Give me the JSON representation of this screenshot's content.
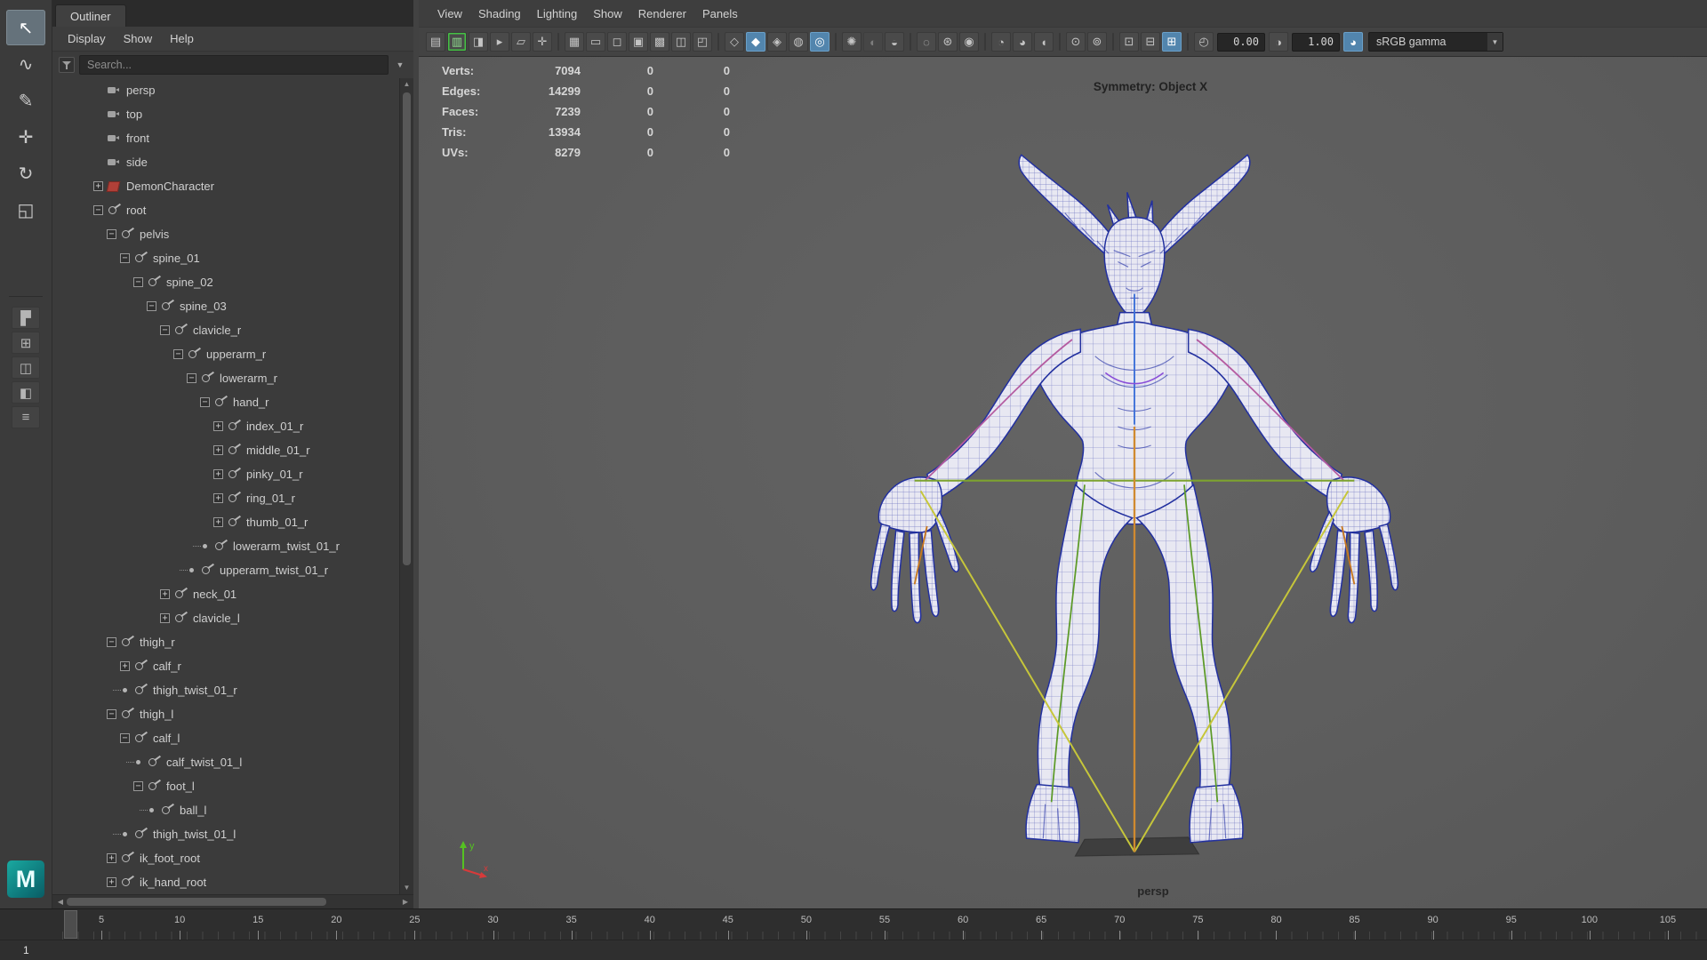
{
  "colors": {
    "accent_blue": "#5285ad",
    "keyed_green": "#44c244",
    "wireframe_navy": "#22309f",
    "skeleton_green": "#7da32f",
    "skeleton_yellow": "#c6c63a",
    "skeleton_orange": "#d08a30",
    "skeleton_magenta": "#b45aa0",
    "maya_teal": "#0d7377"
  },
  "branding": {
    "logo_text": "M"
  },
  "toolbox": {
    "tools": [
      {
        "name": "select-tool",
        "glyph": "↖",
        "state": "active"
      },
      {
        "name": "lasso-select-tool",
        "glyph": "∿",
        "state": ""
      },
      {
        "name": "paint-select-tool",
        "glyph": "✎",
        "state": ""
      },
      {
        "name": "move-tool",
        "glyph": "✛",
        "state": ""
      },
      {
        "name": "rotate-tool",
        "glyph": "↻",
        "state": ""
      },
      {
        "name": "scale-tool",
        "glyph": "◱",
        "state": ""
      }
    ],
    "layouts": [
      {
        "name": "quick-layout-single-pane-button",
        "glyph": "▛"
      },
      {
        "name": "quick-layout-four-pane-button",
        "glyph": "⊞"
      },
      {
        "name": "quick-layout-two-pane-button",
        "glyph": "◫"
      },
      {
        "name": "quick-layout-persp-outliner-button",
        "glyph": "◧"
      },
      {
        "name": "outliner-layout-button",
        "glyph": "≡"
      }
    ]
  },
  "outliner": {
    "tab": "Outliner",
    "menus": [
      {
        "label": "Display",
        "dn": "menu-display"
      },
      {
        "label": "Show",
        "dn": "menu-show"
      },
      {
        "label": "Help",
        "dn": "menu-help"
      }
    ],
    "search_placeholder": "Search...",
    "items": [
      {
        "label": "persp",
        "depth": 0,
        "icon": "camera",
        "exp": "none"
      },
      {
        "label": "top",
        "depth": 0,
        "icon": "camera",
        "exp": "none"
      },
      {
        "label": "front",
        "depth": 0,
        "icon": "camera",
        "exp": "none"
      },
      {
        "label": "side",
        "depth": 0,
        "icon": "camera",
        "exp": "none"
      },
      {
        "label": "DemonCharacter",
        "depth": 0,
        "icon": "mesh",
        "exp": "closed"
      },
      {
        "label": "root",
        "depth": 0,
        "icon": "joint",
        "exp": "open"
      },
      {
        "label": "pelvis",
        "depth": 1,
        "icon": "joint",
        "exp": "open"
      },
      {
        "label": "spine_01",
        "depth": 2,
        "icon": "joint",
        "exp": "open"
      },
      {
        "label": "spine_02",
        "depth": 3,
        "icon": "joint",
        "exp": "open"
      },
      {
        "label": "spine_03",
        "depth": 4,
        "icon": "joint",
        "exp": "open"
      },
      {
        "label": "clavicle_r",
        "depth": 5,
        "icon": "joint",
        "exp": "open"
      },
      {
        "label": "upperarm_r",
        "depth": 6,
        "icon": "joint",
        "exp": "open"
      },
      {
        "label": "lowerarm_r",
        "depth": 7,
        "icon": "joint",
        "exp": "open"
      },
      {
        "label": "hand_r",
        "depth": 8,
        "icon": "joint",
        "exp": "open"
      },
      {
        "label": "index_01_r",
        "depth": 9,
        "icon": "joint",
        "exp": "closed"
      },
      {
        "label": "middle_01_r",
        "depth": 9,
        "icon": "joint",
        "exp": "closed"
      },
      {
        "label": "pinky_01_r",
        "depth": 9,
        "icon": "joint",
        "exp": "closed"
      },
      {
        "label": "ring_01_r",
        "depth": 9,
        "icon": "joint",
        "exp": "closed"
      },
      {
        "label": "thumb_01_r",
        "depth": 9,
        "icon": "joint",
        "exp": "closed"
      },
      {
        "label": "lowerarm_twist_01_r",
        "depth": 8,
        "icon": "joint",
        "exp": "leaf"
      },
      {
        "label": "upperarm_twist_01_r",
        "depth": 7,
        "icon": "joint",
        "exp": "leaf"
      },
      {
        "label": "neck_01",
        "depth": 5,
        "icon": "joint",
        "exp": "closed"
      },
      {
        "label": "clavicle_l",
        "depth": 5,
        "icon": "joint",
        "exp": "closed"
      },
      {
        "label": "thigh_r",
        "depth": 1,
        "icon": "joint",
        "exp": "open"
      },
      {
        "label": "calf_r",
        "depth": 2,
        "icon": "joint",
        "exp": "closed"
      },
      {
        "label": "thigh_twist_01_r",
        "depth": 2,
        "icon": "joint",
        "exp": "leaf"
      },
      {
        "label": "thigh_l",
        "depth": 1,
        "icon": "joint",
        "exp": "open"
      },
      {
        "label": "calf_l",
        "depth": 2,
        "icon": "joint",
        "exp": "open"
      },
      {
        "label": "calf_twist_01_l",
        "depth": 3,
        "icon": "joint",
        "exp": "leaf"
      },
      {
        "label": "foot_l",
        "depth": 3,
        "icon": "joint",
        "exp": "open"
      },
      {
        "label": "ball_l",
        "depth": 4,
        "icon": "joint",
        "exp": "leaf"
      },
      {
        "label": "thigh_twist_01_l",
        "depth": 2,
        "icon": "joint",
        "exp": "leaf"
      },
      {
        "label": "ik_foot_root",
        "depth": 1,
        "icon": "joint",
        "exp": "closed"
      },
      {
        "label": "ik_hand_root",
        "depth": 1,
        "icon": "joint",
        "exp": "closed"
      }
    ]
  },
  "viewport": {
    "menus": [
      {
        "label": "View",
        "dn": "menu-view"
      },
      {
        "label": "Shading",
        "dn": "menu-shading"
      },
      {
        "label": "Lighting",
        "dn": "menu-lighting"
      },
      {
        "label": "Show",
        "dn": "menu-show-panel"
      },
      {
        "label": "Renderer",
        "dn": "menu-renderer"
      },
      {
        "label": "Panels",
        "dn": "menu-panels"
      }
    ],
    "toolbar": {
      "icons": [
        {
          "n": "select-camera-icon",
          "g": "▤",
          "ia": "true"
        },
        {
          "n": "camera-keyframe-icon",
          "g": "▥",
          "s": "keyed",
          "ia": "true"
        },
        {
          "n": "camera-attributes-icon",
          "g": "◨",
          "ia": "true"
        },
        {
          "n": "bookmark-icon",
          "g": "▸",
          "ia": "true"
        },
        {
          "n": "image-plane-icon",
          "g": "▱",
          "ia": "true"
        },
        {
          "n": "two-d-pan-zoom-icon",
          "g": "✛",
          "ia": "true"
        },
        {
          "n": "separator",
          "t": "sep",
          "ia": "false"
        },
        {
          "n": "grid-toggle-icon",
          "g": "▦",
          "ia": "true"
        },
        {
          "n": "film-gate-icon",
          "g": "▭",
          "ia": "true"
        },
        {
          "n": "resolution-gate-icon",
          "g": "◻",
          "ia": "true"
        },
        {
          "n": "gate-mask-icon",
          "g": "▣",
          "ia": "true"
        },
        {
          "n": "field-chart-icon",
          "g": "▩",
          "ia": "true"
        },
        {
          "n": "safe-action-icon",
          "g": "◫",
          "ia": "true"
        },
        {
          "n": "safe-title-icon",
          "g": "◰",
          "ia": "true"
        },
        {
          "n": "separator",
          "t": "sep",
          "ia": "false"
        },
        {
          "n": "wireframe-mode-icon",
          "g": "◇",
          "ia": "true"
        },
        {
          "n": "smooth-shade-icon",
          "g": "◆",
          "s": "on",
          "ia": "true"
        },
        {
          "n": "textured-mode-icon",
          "g": "◈",
          "ia": "true"
        },
        {
          "n": "use-default-material-icon",
          "g": "◍",
          "ia": "true"
        },
        {
          "n": "wireframe-on-shaded-icon",
          "g": "◎",
          "s": "on",
          "ia": "true"
        },
        {
          "n": "separator",
          "t": "sep",
          "ia": "false"
        },
        {
          "n": "use-all-lights-icon",
          "g": "✺",
          "ia": "true"
        },
        {
          "n": "shadows-icon",
          "g": "◐",
          "s": "disabled",
          "ia": "true"
        },
        {
          "n": "screen-space-ao-icon",
          "g": "◒",
          "ia": "true"
        },
        {
          "n": "separator",
          "t": "sep",
          "ia": "false"
        },
        {
          "n": "motion-blur-icon",
          "g": "◌",
          "ia": "true"
        },
        {
          "n": "multisample-aa-icon",
          "g": "⊛",
          "ia": "true"
        },
        {
          "n": "depth-of-field-icon",
          "g": "◉",
          "ia": "true"
        },
        {
          "n": "separator",
          "t": "sep",
          "ia": "false"
        },
        {
          "n": "isolate-select-icon",
          "g": "◔",
          "ia": "true"
        },
        {
          "n": "xray-icon",
          "g": "◕",
          "ia": "true"
        },
        {
          "n": "xray-joints-icon",
          "g": "◖",
          "ia": "true"
        },
        {
          "n": "separator",
          "t": "sep",
          "ia": "false"
        },
        {
          "n": "snap-to-grid-icon",
          "g": "⊙",
          "ia": "true"
        },
        {
          "n": "selection-highlight-icon",
          "g": "⊚",
          "ia": "true"
        },
        {
          "n": "separator",
          "t": "sep",
          "ia": "false"
        },
        {
          "n": "pane-menu-icon",
          "g": "⊡",
          "ia": "true"
        },
        {
          "n": "panel-layout-icon",
          "g": "⊟",
          "ia": "true"
        },
        {
          "n": "tearoff-panel-icon",
          "g": "⊞",
          "s": "on",
          "ia": "true"
        },
        {
          "n": "separator",
          "t": "sep",
          "ia": "false"
        },
        {
          "n": "exposure-icon",
          "g": "◴",
          "ia": "true"
        }
      ],
      "exposure": "0.00",
      "gamma": "1.00",
      "gamma_icon": "◑",
      "color_mgmt_icon": "◕",
      "view_transform": "sRGB gamma"
    },
    "stats": {
      "rows": [
        {
          "label": "Verts:",
          "total": "7094",
          "c2": "0",
          "c3": "0"
        },
        {
          "label": "Edges:",
          "total": "14299",
          "c2": "0",
          "c3": "0"
        },
        {
          "label": "Faces:",
          "total": "7239",
          "c2": "0",
          "c3": "0"
        },
        {
          "label": "Tris:",
          "total": "13934",
          "c2": "0",
          "c3": "0"
        },
        {
          "label": "UVs:",
          "total": "8279",
          "c2": "0",
          "c3": "0"
        }
      ]
    },
    "symmetry_label": "Symmetry: Object X",
    "camera_label": "persp",
    "axis": {
      "y": "y",
      "x": "x"
    }
  },
  "timeline": {
    "ticks": [
      5,
      10,
      15,
      20,
      25,
      30,
      35,
      40,
      45,
      50,
      55,
      60,
      65,
      70,
      75,
      80,
      85,
      90,
      95,
      100,
      105
    ],
    "current_frame": "1"
  }
}
